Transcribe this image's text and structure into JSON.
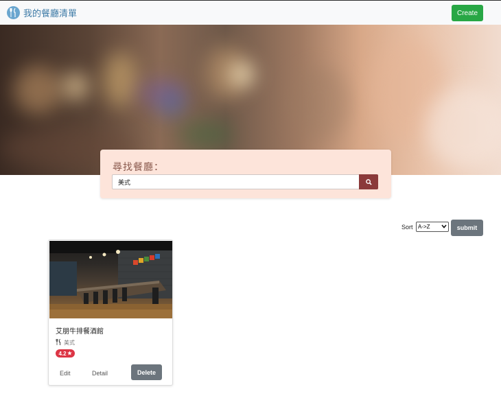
{
  "navbar": {
    "brand_text": "我的餐廳清單",
    "create_label": "Create"
  },
  "search": {
    "title": "尋找餐廳：",
    "value": "美式"
  },
  "sort": {
    "label": "Sort",
    "selected": "A->Z",
    "submit_label": "submit"
  },
  "restaurants": [
    {
      "name": "艾朋牛排餐酒館",
      "category": "美式",
      "rating": "4.2",
      "edit_label": "Edit",
      "detail_label": "Detail",
      "delete_label": "Delete"
    }
  ],
  "colors": {
    "create": "#28a745",
    "search_button": "#8b3a3a",
    "search_panel": "#fde4da",
    "rating_badge": "#dc3545",
    "secondary": "#6c757d",
    "brand": "#3d7aa6"
  },
  "icons": {
    "brand": "utensils-logo-icon",
    "search": "search-icon",
    "category": "utensils-icon",
    "rating": "star-icon"
  }
}
